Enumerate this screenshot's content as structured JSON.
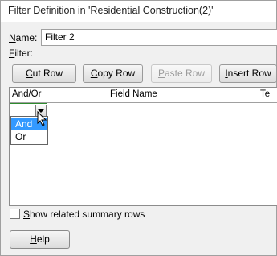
{
  "window": {
    "title": "Filter Definition in 'Residential Construction(2)'"
  },
  "name": {
    "label_accesskey": "N",
    "label_rest": "ame:",
    "value": "Filter 2"
  },
  "filter": {
    "label_accesskey": "F",
    "label_rest": "ilter:"
  },
  "toolbar": {
    "cut": {
      "accesskey": "C",
      "rest": "ut Row",
      "enabled": true
    },
    "copy": {
      "accesskey": "C",
      "rest": "opy Row",
      "enabled": true
    },
    "paste": {
      "accesskey": "P",
      "rest": "aste Row",
      "enabled": false
    },
    "insert": {
      "accesskey": "I",
      "rest": "nsert Row",
      "enabled": true
    }
  },
  "grid": {
    "columns": [
      "And/Or",
      "Field Name",
      "Te"
    ],
    "dropdown_options": [
      "And",
      "Or"
    ],
    "selected_option": "And",
    "accent_color": "#3399ff",
    "active_cell_border": "#2e8b2e"
  },
  "summary_rows": {
    "accesskey": "S",
    "rest": "how related summary rows",
    "checked": false
  },
  "help": {
    "accesskey": "H",
    "rest": "elp"
  }
}
